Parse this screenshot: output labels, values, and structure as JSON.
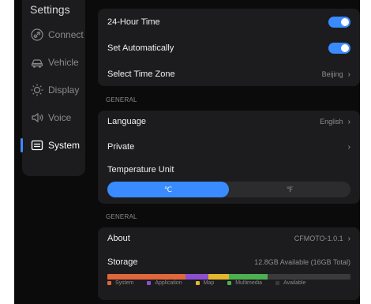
{
  "colors": {
    "accent": "#3a8bff",
    "system": "#e0663c",
    "application": "#8b4fd0",
    "map": "#e2b62d",
    "multimedia": "#4caf50",
    "available": "#3a3a3c"
  },
  "sidebar": {
    "title": "Settings",
    "items": [
      {
        "label": "Connect",
        "icon": "link-icon",
        "active": false
      },
      {
        "label": "Vehicle",
        "icon": "car-icon",
        "active": false
      },
      {
        "label": "Display",
        "icon": "sun-icon",
        "active": false
      },
      {
        "label": "Voice",
        "icon": "speaker-icon",
        "active": false
      },
      {
        "label": "System",
        "icon": "system-icon",
        "active": true
      }
    ]
  },
  "time": {
    "hour24_label": "24-Hour Time",
    "hour24_on": true,
    "auto_label": "Set Automatically",
    "auto_on": true,
    "timezone_label": "Select Time Zone",
    "timezone_value": "Beijing"
  },
  "general1": {
    "section": "GENERAL",
    "language_label": "Language",
    "language_value": "English",
    "private_label": "Private",
    "temp_label": "Temperature Unit",
    "temp_celsius": "℃",
    "temp_fahrenheit": "℉",
    "temp_selected": "celsius"
  },
  "general2": {
    "section": "GENERAL",
    "about_label": "About",
    "about_value": "CFMOTO-1.0.1",
    "storage_label": "Storage",
    "storage_value": "12.8GB Available (16GB Total)",
    "storage_segments": [
      {
        "name": "System",
        "fraction": 0.32
      },
      {
        "name": "Application",
        "fraction": 0.095
      },
      {
        "name": "Map",
        "fraction": 0.085
      },
      {
        "name": "Multimedia",
        "fraction": 0.16
      }
    ],
    "legend": [
      "System",
      "Application",
      "Map",
      "Multimedia",
      "Available"
    ]
  }
}
